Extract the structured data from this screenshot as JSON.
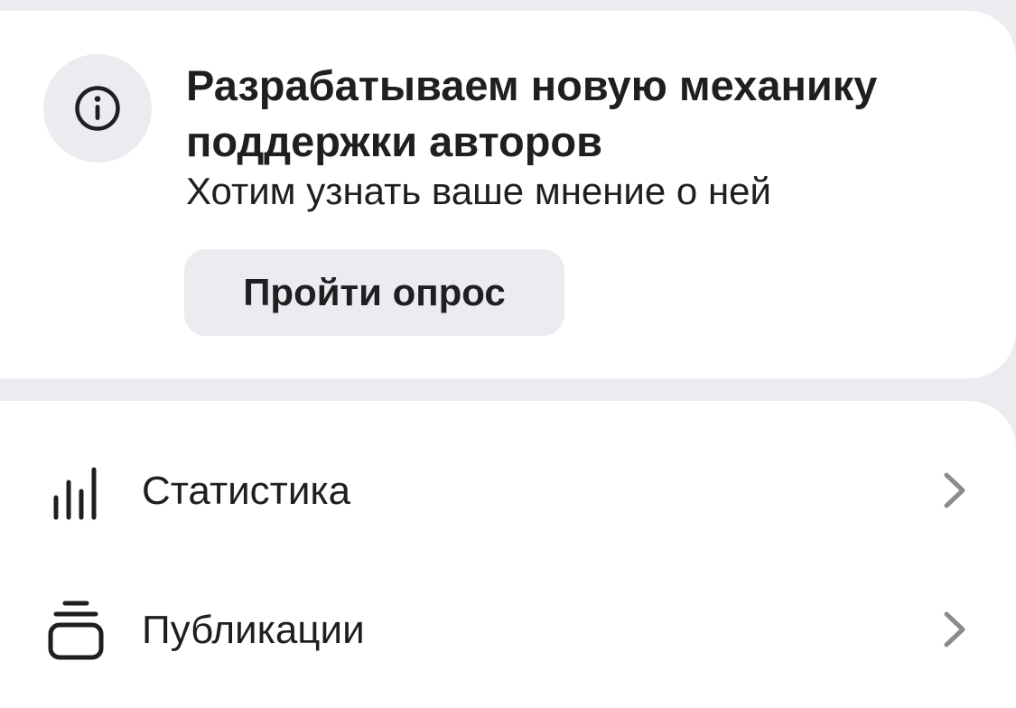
{
  "survey": {
    "title": "Разрабатываем новую механику поддержки авторов",
    "subtitle": "Хотим узнать ваше мнение о ней",
    "button_label": "Пройти опрос",
    "icon": "info-icon"
  },
  "menu": {
    "items": [
      {
        "label": "Статистика",
        "icon": "statistics-icon"
      },
      {
        "label": "Публикации",
        "icon": "publications-icon"
      }
    ]
  },
  "colors": {
    "page_background": "#ebecef",
    "card_background": "#ffffff",
    "text": "#1f1f21",
    "chevron": "#8a8c91",
    "button_background": "#ebecef"
  }
}
